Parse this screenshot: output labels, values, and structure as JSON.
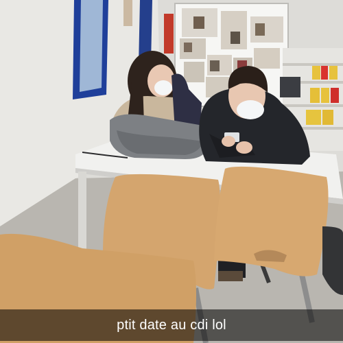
{
  "photo": {
    "caption": "ptit date au cdi lol",
    "colors": {
      "wall": "#e9e8e4",
      "table": "#f1f1ef",
      "chair_wood": "#d4a56e",
      "jacket": "#24262b",
      "backpack": "#7d8084",
      "window_frame": "#1f3f9a",
      "caption_bg": "#00000099"
    }
  }
}
